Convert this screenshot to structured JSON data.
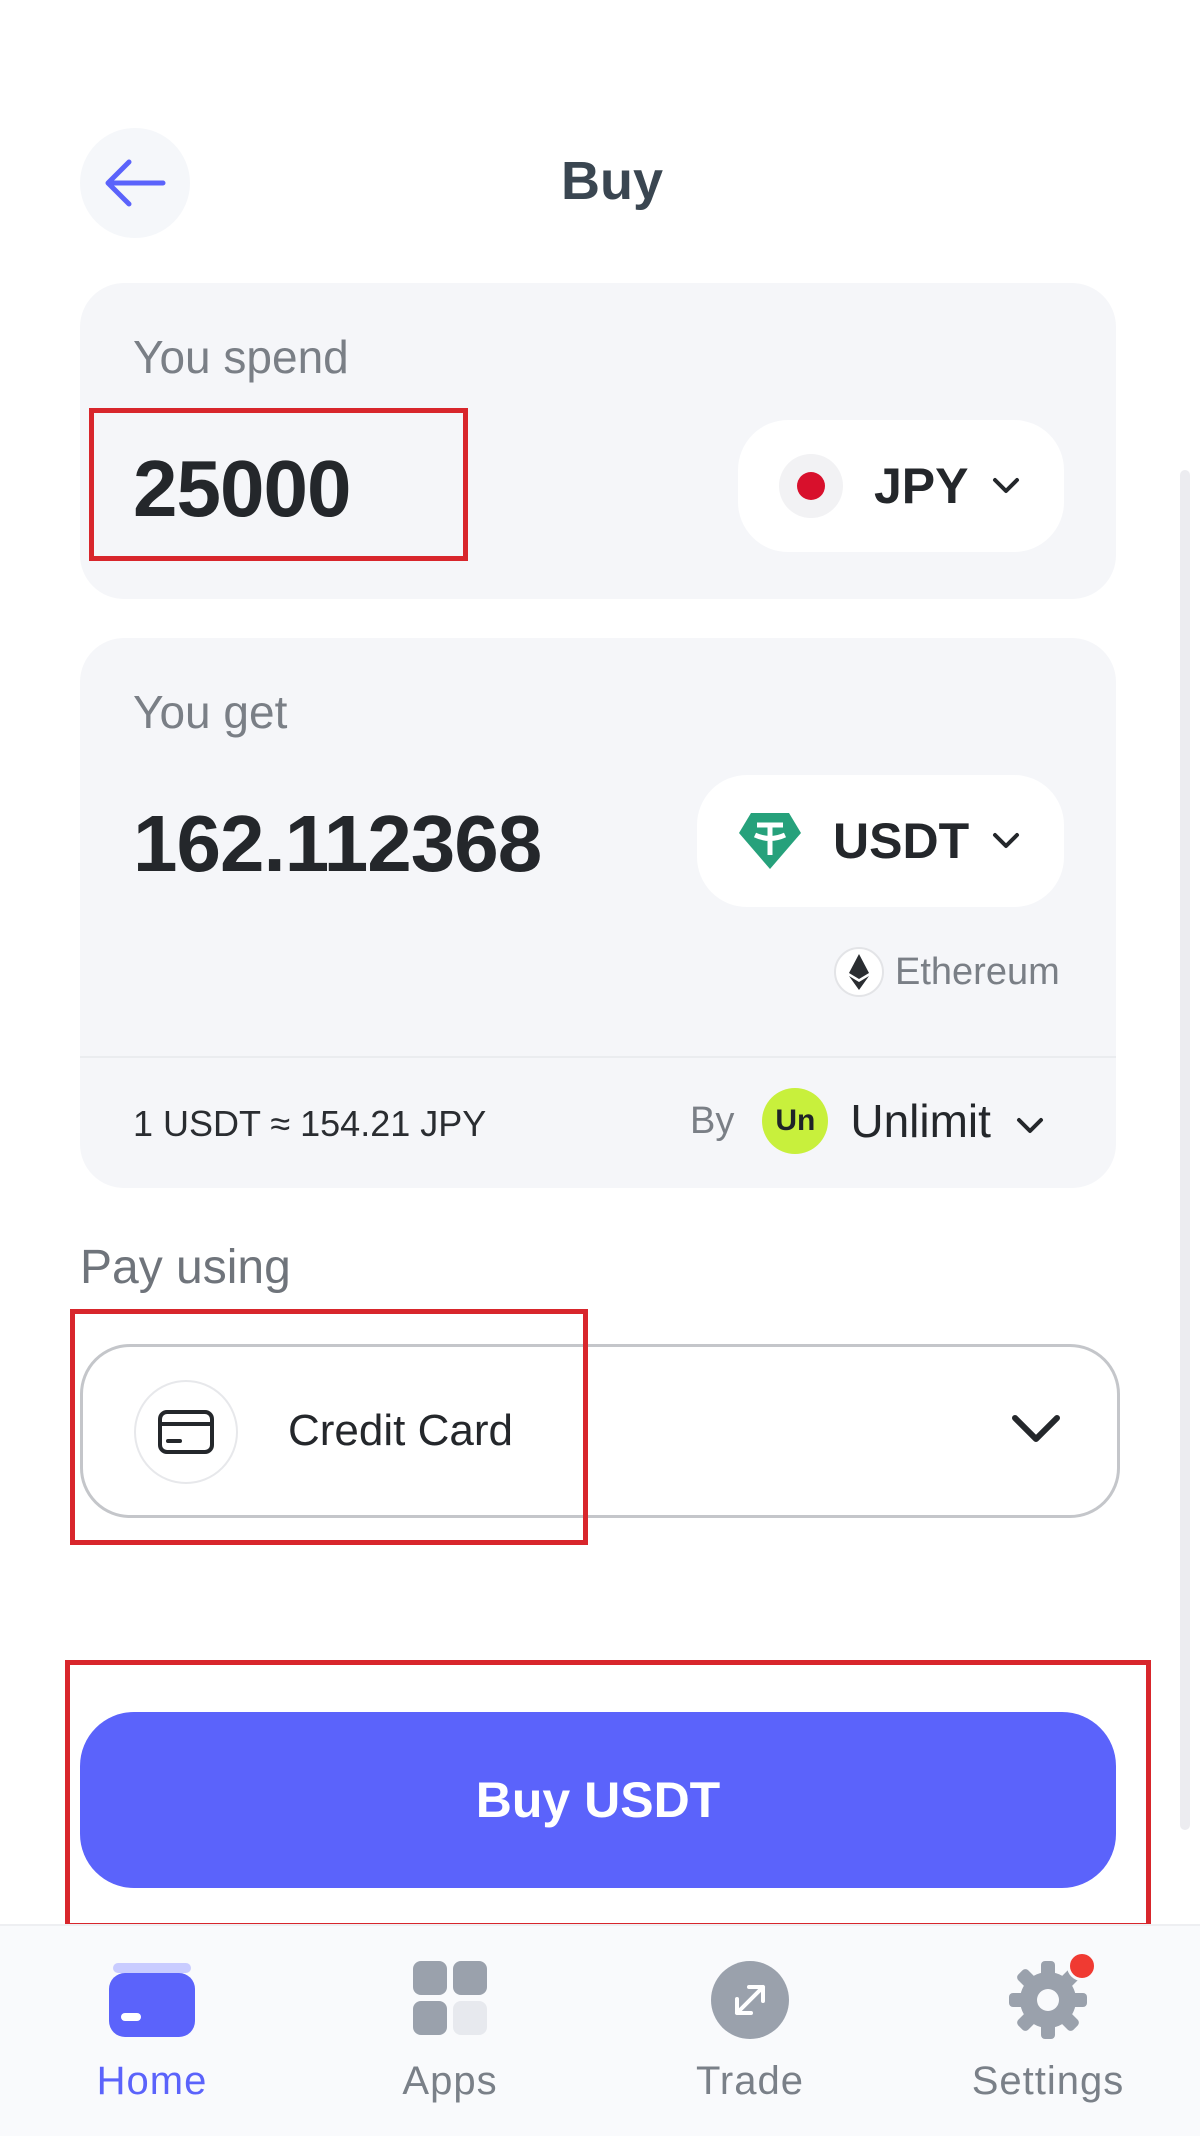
{
  "header": {
    "title": "Buy"
  },
  "spend": {
    "label": "You spend",
    "amount": "25000",
    "currency": "JPY"
  },
  "get": {
    "label": "You get",
    "amount": "162.112368",
    "currency": "USDT",
    "network": "Ethereum"
  },
  "quote": {
    "rate": "1 USDT ≈ 154.21 JPY",
    "by_label": "By",
    "provider": "Unlimit",
    "provider_logo": "Un"
  },
  "payment": {
    "section_label": "Pay using",
    "method": "Credit Card"
  },
  "buy_button": {
    "label": "Buy USDT"
  },
  "nav": {
    "items": [
      {
        "label": "Home",
        "icon": "wallet-icon",
        "active": true
      },
      {
        "label": "Apps",
        "icon": "apps-grid-icon"
      },
      {
        "label": "Trade",
        "icon": "trade-swap-icon"
      },
      {
        "label": "Settings",
        "icon": "gear-icon",
        "badge": true
      }
    ]
  },
  "colors": {
    "accent": "#5b63fb",
    "highlight": "#d8262c",
    "tether": "#26a17b",
    "unlimit": "#c8f03c",
    "badge": "#f03a32"
  }
}
